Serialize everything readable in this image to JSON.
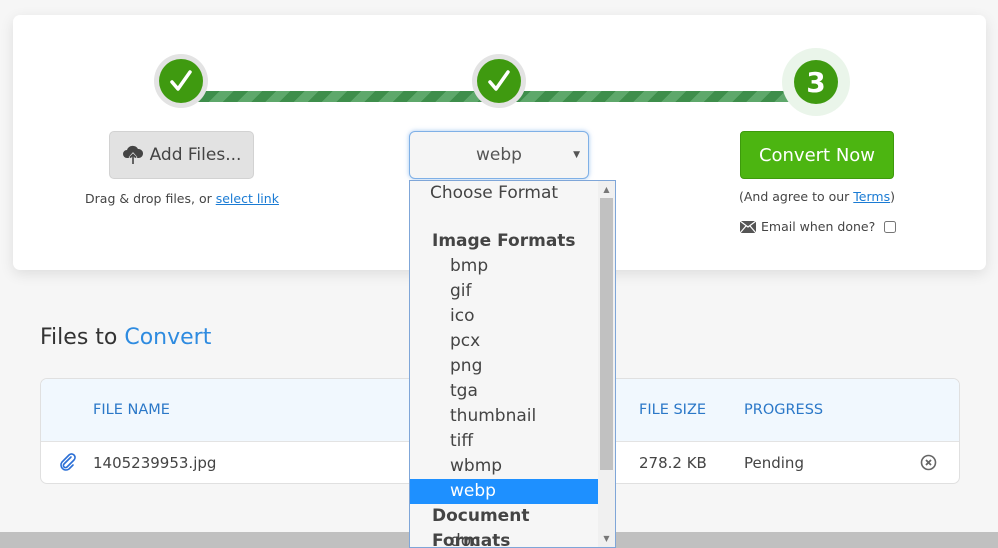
{
  "steps": [
    {
      "index": 1,
      "state": "complete",
      "icon": "checkmark-icon"
    },
    {
      "index": 2,
      "state": "complete",
      "icon": "checkmark-icon"
    },
    {
      "index": 3,
      "state": "current",
      "label": "3"
    }
  ],
  "upload": {
    "button_label": "Add Files...",
    "button_icon": "cloud-upload-icon",
    "drag_text": "Drag & drop files, or ",
    "select_link": "select link"
  },
  "format": {
    "selected": "webp",
    "dropdown": {
      "placeholder": "Choose Format",
      "groups": [
        {
          "label": "Image Formats",
          "options": [
            "bmp",
            "gif",
            "ico",
            "pcx",
            "png",
            "tga",
            "thumbnail",
            "tiff",
            "wbmp",
            "webp"
          ]
        },
        {
          "label": "Document Formats",
          "options": [
            "doc"
          ]
        }
      ],
      "highlighted": "webp"
    }
  },
  "convert": {
    "button_label": "Convert Now",
    "terms_prefix": "(And agree to our ",
    "terms_link": "Terms",
    "terms_suffix": ")",
    "email_label": "Email when done?",
    "email_checked": false
  },
  "files_section": {
    "title_plain": "Files to ",
    "title_accent": "Convert",
    "columns": {
      "name": "FILE NAME",
      "size": "FILE SIZE",
      "progress": "PROGRESS"
    },
    "rows": [
      {
        "name": "1405239953.jpg",
        "size": "278.2 KB",
        "progress": "Pending"
      }
    ]
  },
  "colors": {
    "step_green": "#3f9a10",
    "convert_green": "#4cb511",
    "accent_blue": "#2e8be0",
    "selected_option": "#1e90ff"
  }
}
